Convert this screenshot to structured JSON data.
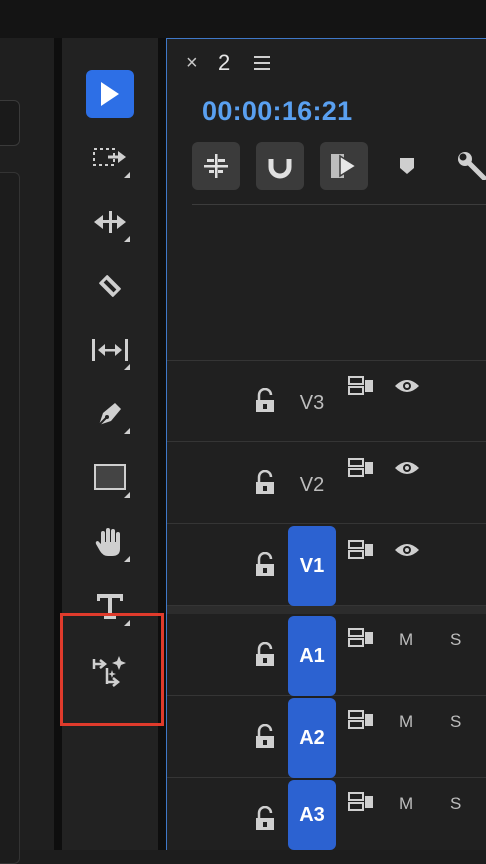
{
  "tools": [
    {
      "name": "selection-tool",
      "icon": "arrow-pointer-icon",
      "selected": true
    },
    {
      "name": "track-select-forward-tool",
      "icon": "track-select-icon"
    },
    {
      "name": "ripple-edit-tool",
      "icon": "ripple-edit-icon"
    },
    {
      "name": "razor-tool",
      "icon": "razor-blade-icon"
    },
    {
      "name": "slip-tool",
      "icon": "slip-icon"
    },
    {
      "name": "pen-tool",
      "icon": "pen-icon"
    },
    {
      "name": "rectangle-tool",
      "icon": "rectangle-icon"
    },
    {
      "name": "hand-tool",
      "icon": "hand-icon"
    },
    {
      "name": "type-tool",
      "icon": "type-icon"
    },
    {
      "name": "remix-tool",
      "icon": "remix-icon",
      "highlighted": true
    }
  ],
  "panel": {
    "close_label": "×",
    "tab_name": "2",
    "timecode": "00:00:16:21",
    "accent_color": "#5aa0f0",
    "highlight_color": "#e03b2c"
  },
  "toolbar_buttons": [
    {
      "name": "insert-sequence-button",
      "icon": "nest-icon"
    },
    {
      "name": "snap-button",
      "icon": "magnet-icon"
    },
    {
      "name": "linked-selection-button",
      "icon": "linked-selection-icon"
    },
    {
      "name": "add-marker-button",
      "icon": "marker-icon"
    },
    {
      "name": "timeline-settings-button",
      "icon": "wrench-icon"
    }
  ],
  "tracks": {
    "v3": {
      "label": "V3"
    },
    "v2": {
      "label": "V2"
    },
    "v1": {
      "label": "V1"
    },
    "a1": {
      "label": "A1",
      "mute": "M",
      "solo": "S"
    },
    "a2": {
      "label": "A2",
      "mute": "M",
      "solo": "S"
    },
    "a3": {
      "label": "A3",
      "mute": "M",
      "solo": "S"
    }
  }
}
